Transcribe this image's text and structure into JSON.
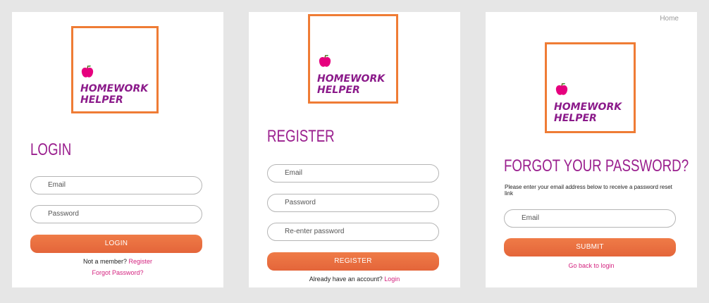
{
  "logo": {
    "line1": "HOMEWORK",
    "line2": "HELPER",
    "apple_icon": "apple-icon",
    "apple_color": "#e6007e",
    "text_color": "#8b1a8a",
    "border_color": "#ef7c35"
  },
  "login": {
    "title": "LOGIN",
    "email_placeholder": "Email",
    "password_placeholder": "Password",
    "button": "LOGIN",
    "not_member": "Not a member?",
    "register_link": "Register",
    "forgot_link": "Forgot Password?"
  },
  "register": {
    "title": "REGISTER",
    "email_placeholder": "Email",
    "password_placeholder": "Password",
    "reenter_placeholder": "Re-enter password",
    "button": "REGISTER",
    "have_account": "Already have an account?",
    "login_link": "Login"
  },
  "forgot": {
    "home_link": "Home",
    "title": "FORGOT YOUR PASSWORD?",
    "description": "Please enter your email address below to receive a password reset link",
    "email_placeholder": "Email",
    "button": "SUBMIT",
    "back_link": "Go back to login"
  },
  "colors": {
    "title": "#9a1f8e",
    "button": "#e96d3f",
    "link": "#d4237f",
    "background": "#e6e6e6"
  }
}
